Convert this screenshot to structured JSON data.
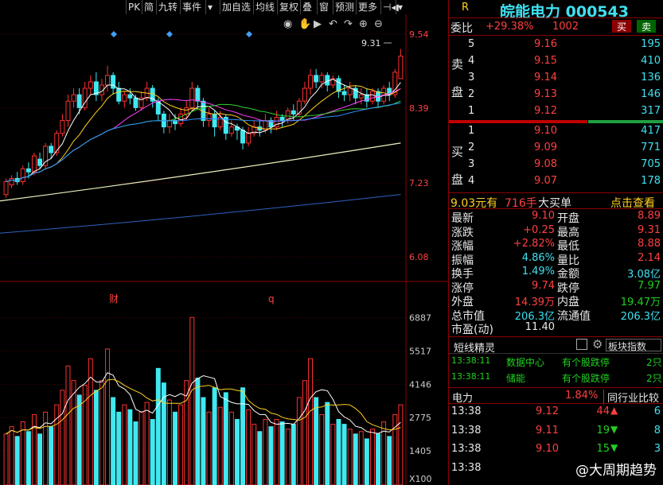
{
  "toolbar": {
    "items": [
      "PK",
      "简",
      "九转",
      "事件",
      "▾",
      "加自选",
      "均线",
      "复权",
      "叠",
      "窗",
      "预测",
      "更多",
      "⊣◀",
      "▾"
    ]
  },
  "chart": {
    "price_ticks": [
      "9.54",
      "8.39",
      "7.23",
      "6.08"
    ],
    "vol_ticks": [
      "6887",
      "5517",
      "4146",
      "2775",
      "1405",
      "X100"
    ],
    "last_label": "9.31",
    "event_markers": [
      "财",
      "q"
    ],
    "tool_icons": [
      "eye-icon",
      "hand-icon",
      "play-icon",
      "undo-icon",
      "redo-icon",
      "zoom-in-icon",
      "zoom-out-icon"
    ]
  },
  "stock": {
    "r": "R",
    "name": "皖能电力",
    "code": "000543"
  },
  "weibi": {
    "label": "委比",
    "pct": "+29.38%",
    "diff": "1002",
    "buy": "买",
    "sell": "卖"
  },
  "sell_label": [
    "卖",
    "盘"
  ],
  "buy_label": [
    "买",
    "盘"
  ],
  "asks": [
    {
      "n": "5",
      "p": "9.16",
      "v": "195"
    },
    {
      "n": "4",
      "p": "9.15",
      "v": "410"
    },
    {
      "n": "3",
      "p": "9.14",
      "v": "136"
    },
    {
      "n": "2",
      "p": "9.13",
      "v": "146"
    },
    {
      "n": "1",
      "p": "9.12",
      "v": "317"
    }
  ],
  "bids": [
    {
      "n": "1",
      "p": "9.10",
      "v": "417"
    },
    {
      "n": "2",
      "p": "9.09",
      "v": "771"
    },
    {
      "n": "3",
      "p": "9.08",
      "v": "705"
    },
    {
      "n": "4",
      "p": "9.07",
      "v": "178"
    }
  ],
  "bigorder": {
    "price": "9.03元有",
    "qty": "716手",
    "label": "大买单",
    "link": "点击查看"
  },
  "stats": [
    {
      "l": "最新",
      "v": "9.10",
      "vc": "red",
      "l2": "开盘",
      "v2": "8.89",
      "v2c": "red"
    },
    {
      "l": "涨跌",
      "v": "+0.25",
      "vc": "red",
      "l2": "最高",
      "v2": "9.31",
      "v2c": "red"
    },
    {
      "l": "涨幅",
      "v": "+2.82%",
      "vc": "red",
      "l2": "最低",
      "v2": "8.88",
      "v2c": "red"
    },
    {
      "l": "振幅",
      "v": "4.86%",
      "vc": "cyan",
      "l2": "量比",
      "v2": "2.14",
      "v2c": "red"
    },
    {
      "l": "换手",
      "v": "1.49%",
      "vc": "cyan",
      "l2": "金额",
      "v2": "3.08亿",
      "v2c": "cyan"
    },
    {
      "l": "涨停",
      "v": "9.74",
      "vc": "red",
      "l2": "跌停",
      "v2": "7.97",
      "v2c": "green"
    },
    {
      "l": "外盘",
      "v": "14.39万",
      "vc": "red",
      "l2": "内盘",
      "v2": "19.47万",
      "v2c": "green"
    },
    {
      "l": "总市值",
      "v": "206.3亿",
      "vc": "cyan",
      "l2": "流通值",
      "v2": "206.3亿",
      "v2c": "cyan"
    },
    {
      "l": "市盈(动)",
      "v": "11.40",
      "vc": "white",
      "l2": "",
      "v2": "",
      "v2c": "white"
    }
  ],
  "sprite": {
    "title": "短线精灵",
    "index": "板块指数",
    "rows": [
      {
        "t": "13:38:11",
        "a": "数据中心",
        "b": "有个股跌停",
        "c": "2只"
      },
      {
        "t": "13:38:11",
        "a": "储能",
        "b": "有个股跌停",
        "c": "2只"
      }
    ]
  },
  "industry": {
    "name": "电力",
    "pct": "1.84%",
    "label": "同行业比较"
  },
  "ticks": [
    {
      "t": "13:38",
      "p": "9.12",
      "v": "44",
      "d": "up",
      "n": "6"
    },
    {
      "t": "13:38",
      "p": "9.11",
      "v": "19",
      "d": "down",
      "n": "8"
    },
    {
      "t": "13:38",
      "p": "9.10",
      "v": "15",
      "d": "down",
      "n": "3"
    },
    {
      "t": "13:38",
      "p": "",
      "v": "",
      "d": "",
      "n": ""
    }
  ],
  "watermark": "@大周期趋势",
  "chart_data": {
    "type": "candlestick",
    "price_axis": [
      6.08,
      7.23,
      8.39,
      9.54
    ],
    "candles": [
      [
        7.05,
        7.25,
        7.0,
        7.3
      ],
      [
        7.2,
        7.3,
        7.15,
        7.35
      ],
      [
        7.3,
        7.25,
        7.2,
        7.4
      ],
      [
        7.25,
        7.45,
        7.2,
        7.5
      ],
      [
        7.45,
        7.4,
        7.3,
        7.55
      ],
      [
        7.4,
        7.65,
        7.35,
        7.7
      ],
      [
        7.6,
        7.5,
        7.45,
        7.7
      ],
      [
        7.5,
        7.8,
        7.45,
        7.85
      ],
      [
        7.8,
        7.7,
        7.6,
        7.85
      ],
      [
        7.7,
        8.0,
        7.65,
        8.05
      ],
      [
        8.0,
        8.2,
        7.95,
        8.3
      ],
      [
        8.2,
        8.5,
        8.1,
        8.6
      ],
      [
        8.5,
        8.6,
        8.4,
        8.7
      ],
      [
        8.6,
        8.4,
        8.3,
        8.7
      ],
      [
        8.4,
        8.7,
        8.35,
        8.8
      ],
      [
        8.7,
        8.8,
        8.6,
        8.9
      ],
      [
        8.8,
        8.6,
        8.5,
        8.95
      ],
      [
        8.6,
        8.75,
        8.5,
        8.85
      ],
      [
        8.75,
        8.9,
        8.65,
        9.05
      ],
      [
        8.9,
        8.7,
        8.6,
        8.95
      ],
      [
        8.7,
        8.5,
        8.45,
        8.8
      ],
      [
        8.5,
        8.6,
        8.4,
        8.65
      ],
      [
        8.6,
        8.55,
        8.45,
        8.7
      ],
      [
        8.55,
        8.4,
        8.35,
        8.6
      ],
      [
        8.4,
        8.55,
        8.35,
        8.65
      ],
      [
        8.55,
        8.7,
        8.5,
        8.8
      ],
      [
        8.7,
        8.5,
        8.4,
        8.75
      ],
      [
        8.5,
        8.3,
        8.2,
        8.55
      ],
      [
        8.3,
        8.1,
        8.0,
        8.35
      ],
      [
        8.1,
        8.2,
        8.0,
        8.3
      ],
      [
        8.2,
        8.15,
        8.05,
        8.3
      ],
      [
        8.15,
        8.3,
        8.1,
        8.4
      ],
      [
        8.3,
        8.4,
        8.2,
        8.5
      ],
      [
        8.4,
        8.7,
        8.35,
        8.8
      ],
      [
        8.7,
        8.5,
        8.4,
        8.75
      ],
      [
        8.5,
        8.2,
        8.1,
        8.55
      ],
      [
        8.2,
        8.3,
        8.1,
        8.4
      ],
      [
        8.3,
        8.1,
        7.95,
        8.35
      ],
      [
        8.1,
        8.25,
        8.05,
        8.35
      ],
      [
        8.25,
        8.0,
        7.9,
        8.3
      ],
      [
        8.0,
        8.1,
        7.95,
        8.2
      ],
      [
        8.1,
        8.05,
        7.9,
        8.15
      ],
      [
        8.05,
        7.85,
        7.75,
        8.1
      ],
      [
        7.85,
        8.0,
        7.8,
        8.1
      ],
      [
        8.0,
        8.1,
        7.95,
        8.2
      ],
      [
        8.1,
        8.05,
        7.95,
        8.2
      ],
      [
        8.05,
        8.2,
        8.0,
        8.3
      ],
      [
        8.2,
        8.1,
        8.0,
        8.25
      ],
      [
        8.1,
        8.25,
        8.05,
        8.35
      ],
      [
        8.25,
        8.2,
        8.1,
        8.3
      ],
      [
        8.2,
        8.35,
        8.15,
        8.4
      ],
      [
        8.35,
        8.3,
        8.2,
        8.45
      ],
      [
        8.3,
        8.5,
        8.25,
        8.55
      ],
      [
        8.5,
        8.7,
        8.45,
        8.8
      ],
      [
        8.7,
        8.9,
        8.6,
        9.0
      ],
      [
        8.9,
        8.8,
        8.7,
        9.0
      ],
      [
        8.8,
        8.9,
        8.7,
        8.95
      ],
      [
        8.9,
        8.75,
        8.65,
        8.95
      ],
      [
        8.75,
        8.85,
        8.7,
        8.9
      ],
      [
        8.85,
        8.65,
        8.55,
        8.9
      ],
      [
        8.65,
        8.6,
        8.5,
        8.75
      ],
      [
        8.6,
        8.7,
        8.5,
        8.8
      ],
      [
        8.7,
        8.55,
        8.45,
        8.75
      ],
      [
        8.55,
        8.6,
        8.45,
        8.7
      ],
      [
        8.6,
        8.5,
        8.4,
        8.7
      ],
      [
        8.5,
        8.65,
        8.45,
        8.7
      ],
      [
        8.65,
        8.5,
        8.4,
        8.7
      ],
      [
        8.5,
        8.7,
        8.45,
        8.75
      ],
      [
        8.7,
        8.6,
        8.5,
        8.8
      ],
      [
        8.6,
        8.95,
        8.55,
        9.0
      ],
      [
        8.85,
        9.2,
        8.85,
        9.31
      ]
    ],
    "volumes": [
      2100,
      2400,
      2000,
      2600,
      2200,
      2900,
      2100,
      3000,
      2400,
      3300,
      3900,
      4900,
      4300,
      3700,
      4100,
      5200,
      3900,
      4300,
      5600,
      3600,
      3000,
      3300,
      3100,
      2600,
      3000,
      3400,
      2700,
      4800,
      4200,
      3500,
      3000,
      3300,
      4300,
      6900,
      4400,
      3600,
      3000,
      4000,
      3200,
      3800,
      3000,
      2700,
      4000,
      3100,
      2500,
      2200,
      2700,
      2400,
      2700,
      2600,
      2300,
      2500,
      3600,
      4300,
      5200,
      3600,
      2900,
      3400,
      2500,
      2700,
      2500,
      2300,
      2100,
      2200,
      1900,
      2300,
      2100,
      2600,
      2000,
      2900,
      3300
    ],
    "vol_axis": [
      1405,
      2775,
      4146,
      5517,
      6887
    ]
  }
}
